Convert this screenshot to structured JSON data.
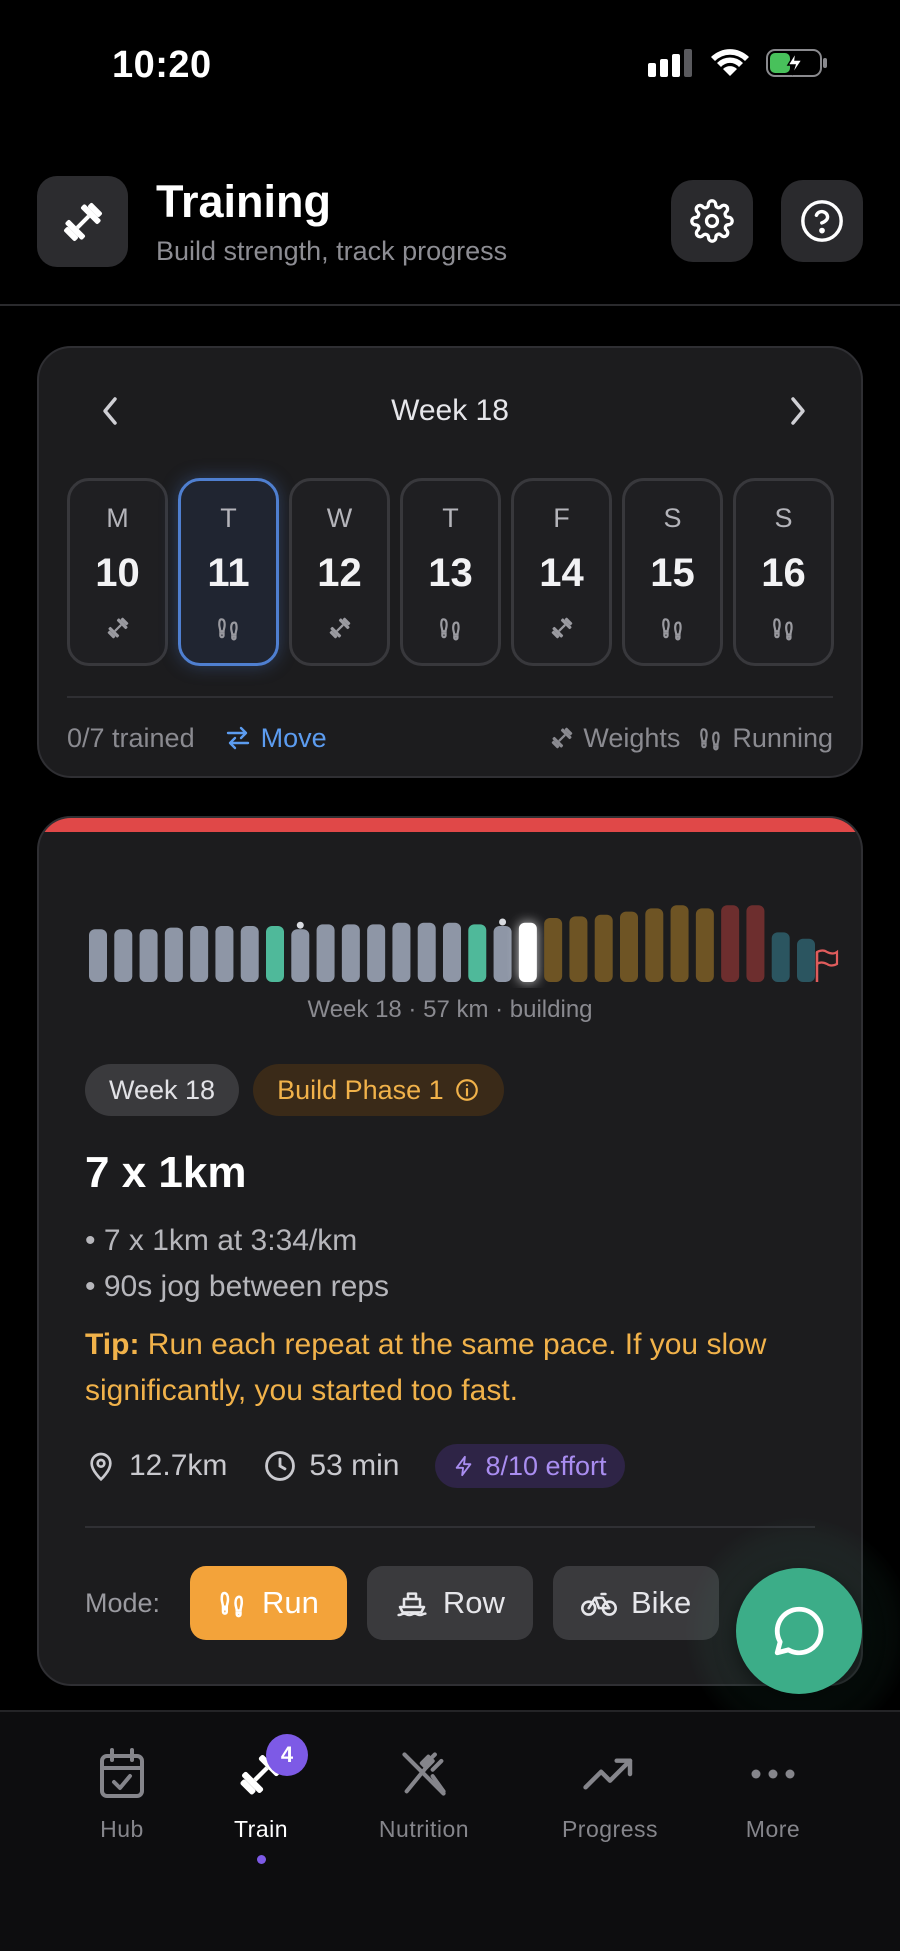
{
  "status_bar": {
    "time": "10:20"
  },
  "header": {
    "title": "Training",
    "subtitle": "Build strength, track progress"
  },
  "week": {
    "title": "Week 18",
    "days": [
      {
        "letter": "M",
        "num": "10",
        "type": "weights"
      },
      {
        "letter": "T",
        "num": "11",
        "type": "running",
        "selected": true
      },
      {
        "letter": "W",
        "num": "12",
        "type": "weights"
      },
      {
        "letter": "T",
        "num": "13",
        "type": "running"
      },
      {
        "letter": "F",
        "num": "14",
        "type": "weights"
      },
      {
        "letter": "S",
        "num": "15",
        "type": "running"
      },
      {
        "letter": "S",
        "num": "16",
        "type": "running"
      }
    ],
    "trained": "0/7 trained",
    "move_label": "Move",
    "legend": {
      "weights": "Weights",
      "running": "Running"
    }
  },
  "plan": {
    "bars": [
      {
        "h": 0.66,
        "c": "#8e96a6"
      },
      {
        "h": 0.66,
        "c": "#8e96a6"
      },
      {
        "h": 0.66,
        "c": "#8e96a6"
      },
      {
        "h": 0.68,
        "c": "#8e96a6"
      },
      {
        "h": 0.7,
        "c": "#8e96a6"
      },
      {
        "h": 0.7,
        "c": "#8e96a6"
      },
      {
        "h": 0.7,
        "c": "#8e96a6"
      },
      {
        "h": 0.7,
        "c": "#4fb99a"
      },
      {
        "h": 0.66,
        "c": "#8e96a6",
        "dot": true
      },
      {
        "h": 0.72,
        "c": "#8e96a6"
      },
      {
        "h": 0.72,
        "c": "#8e96a6"
      },
      {
        "h": 0.72,
        "c": "#8e96a6"
      },
      {
        "h": 0.74,
        "c": "#8e96a6"
      },
      {
        "h": 0.74,
        "c": "#8e96a6"
      },
      {
        "h": 0.74,
        "c": "#8e96a6"
      },
      {
        "h": 0.72,
        "c": "#4fb99a"
      },
      {
        "h": 0.7,
        "c": "#8e96a6",
        "dot": true
      },
      {
        "h": 0.74,
        "c": "#ffffff",
        "current": true
      },
      {
        "h": 0.8,
        "c": "#6e5424"
      },
      {
        "h": 0.82,
        "c": "#6e5424"
      },
      {
        "h": 0.84,
        "c": "#6e5424"
      },
      {
        "h": 0.88,
        "c": "#6e5424"
      },
      {
        "h": 0.92,
        "c": "#6e5424"
      },
      {
        "h": 0.96,
        "c": "#6e5424"
      },
      {
        "h": 0.92,
        "c": "#6e5424"
      },
      {
        "h": 0.96,
        "c": "#6d2e2e"
      },
      {
        "h": 0.96,
        "c": "#6d2e2e"
      },
      {
        "h": 0.62,
        "c": "#2b5560"
      },
      {
        "h": 0.54,
        "c": "#2b5560"
      }
    ],
    "caption": "Week 18 · 57 km · building",
    "week_chip": "Week 18",
    "phase_chip": "Build Phase 1"
  },
  "workout": {
    "title": "7 x 1km",
    "bullets": [
      "• 7 x 1km at 3:34/km",
      "• 90s jog between reps"
    ],
    "tip_label": "Tip:",
    "tip_text": " Run each repeat at the same pace. If you slow significantly, you started too fast.",
    "distance": "12.7km",
    "duration": "53 min",
    "effort": "8/10 effort",
    "mode_label": "Mode:",
    "modes": [
      "Run",
      "Row",
      "Bike"
    ]
  },
  "nav": {
    "items": [
      "Hub",
      "Train",
      "Nutrition",
      "Progress",
      "More"
    ],
    "train_badge": "4"
  },
  "colors": {
    "accent_orange": "#f3a33a",
    "accent_blue": "#5c9cf0",
    "accent_purple": "#7d5ae6",
    "fab_green": "#3cad88"
  }
}
